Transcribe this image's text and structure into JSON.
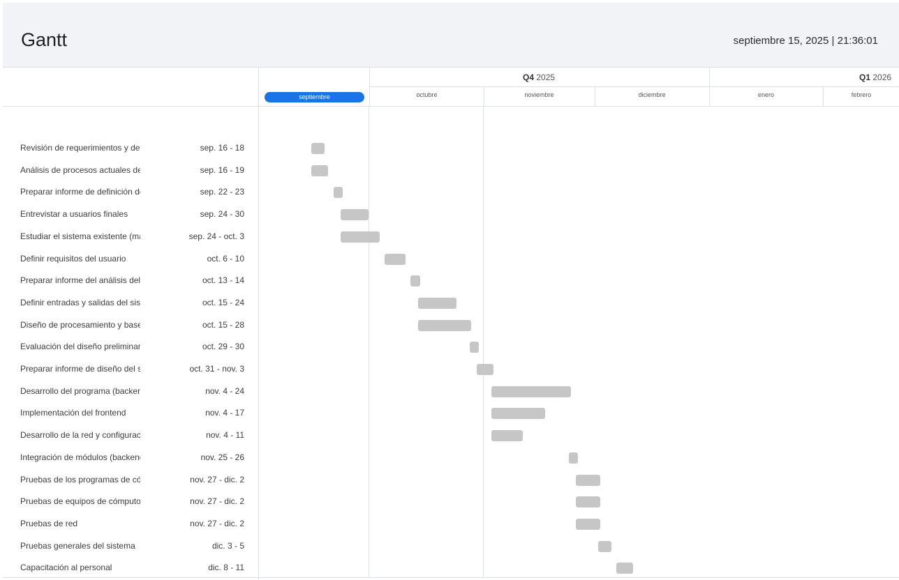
{
  "header": {
    "title": "Gantt",
    "datetime": "septiembre 15, 2025 | 21:36:01"
  },
  "timeline": {
    "quarters": [
      {
        "label": "Q4",
        "year": "2025"
      },
      {
        "label": "Q1",
        "year": "2026"
      }
    ],
    "months": [
      "septiembre",
      "octubre",
      "noviembre",
      "diciembre",
      "enero",
      "febrero"
    ],
    "current_month": "septiembre"
  },
  "tasks": [
    {
      "name": "Revisión de requerimientos y definición del problema",
      "dates": "sep. 16 - 18",
      "start": "2025-09-16",
      "end": "2025-09-18"
    },
    {
      "name": "Análisis de procesos actuales del negocio",
      "dates": "sep. 16 - 19",
      "start": "2025-09-16",
      "end": "2025-09-19"
    },
    {
      "name": "Preparar informe de definición del proyecto",
      "dates": "sep. 22 - 23",
      "start": "2025-09-22",
      "end": "2025-09-23"
    },
    {
      "name": "Entrevistar a usuarios finales",
      "dates": "sep. 24 - 30",
      "start": "2025-09-24",
      "end": "2025-09-30"
    },
    {
      "name": "Estudiar el sistema existente (manual)",
      "dates": "sep. 24 - oct. 3",
      "start": "2025-09-24",
      "end": "2025-10-03"
    },
    {
      "name": "Definir requisitos del usuario",
      "dates": "oct. 6 - 10",
      "start": "2025-10-06",
      "end": "2025-10-10"
    },
    {
      "name": "Preparar informe del análisis del sistema",
      "dates": "oct. 13 - 14",
      "start": "2025-10-13",
      "end": "2025-10-14"
    },
    {
      "name": "Definir entradas y salidas del sistema",
      "dates": "oct. 15 - 24",
      "start": "2025-10-15",
      "end": "2025-10-24"
    },
    {
      "name": "Diseño de procesamiento y base de datos",
      "dates": "oct. 15 - 28",
      "start": "2025-10-15",
      "end": "2025-10-28"
    },
    {
      "name": "Evaluación del diseño preliminar",
      "dates": "oct. 29 - 30",
      "start": "2025-10-29",
      "end": "2025-10-30"
    },
    {
      "name": "Preparar informe de diseño del sistema",
      "dates": "oct. 31 - nov. 3",
      "start": "2025-10-31",
      "end": "2025-11-03"
    },
    {
      "name": "Desarrollo del programa (backend)",
      "dates": "nov. 4 - 24",
      "start": "2025-11-04",
      "end": "2025-11-24"
    },
    {
      "name": "Implementación del frontend",
      "dates": "nov. 4 - 17",
      "start": "2025-11-04",
      "end": "2025-11-17"
    },
    {
      "name": "Desarrollo de la red y configuración",
      "dates": "nov. 4 - 11",
      "start": "2025-11-04",
      "end": "2025-11-11"
    },
    {
      "name": "Integración de módulos (backend y frontend)",
      "dates": "nov. 25 - 26",
      "start": "2025-11-25",
      "end": "2025-11-26"
    },
    {
      "name": "Pruebas de los programas de cómputo",
      "dates": "nov. 27 - dic. 2",
      "start": "2025-11-27",
      "end": "2025-12-02"
    },
    {
      "name": "Pruebas de equipos de cómputo",
      "dates": "nov. 27 - dic. 2",
      "start": "2025-11-27",
      "end": "2025-12-02"
    },
    {
      "name": "Pruebas de red",
      "dates": "nov. 27 - dic. 2",
      "start": "2025-11-27",
      "end": "2025-12-02"
    },
    {
      "name": "Pruebas generales del sistema",
      "dates": "dic. 3 - 5",
      "start": "2025-12-03",
      "end": "2025-12-05"
    },
    {
      "name": "Capacitación al personal",
      "dates": "dic. 8 - 11",
      "start": "2025-12-08",
      "end": "2025-12-11"
    }
  ]
}
